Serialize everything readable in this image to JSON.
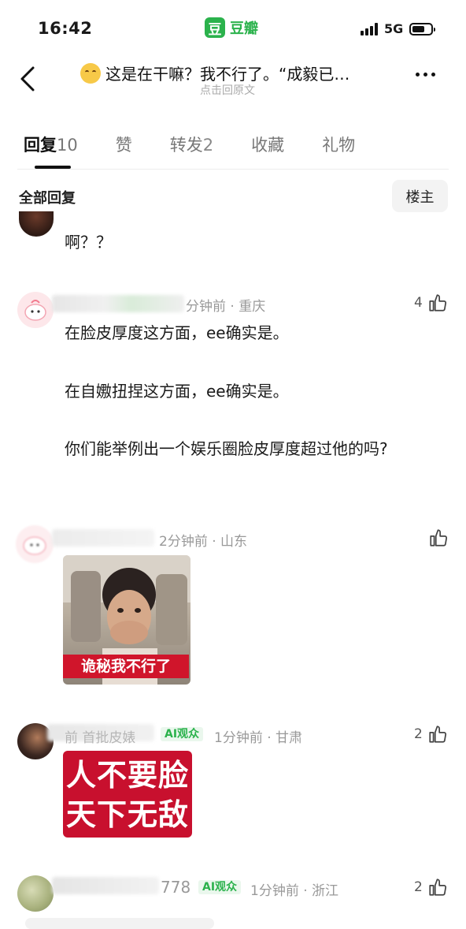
{
  "status_bar": {
    "time": "16:42",
    "app_logo_char": "豆",
    "app_name": "豆瓣",
    "network": "5G"
  },
  "header": {
    "title": "这是在干嘛？我不行了。“成毅已…",
    "subtitle": "点击回原文",
    "emoji_icon": "smiling-face-icon"
  },
  "tabs": [
    {
      "label": "回复",
      "count": "10",
      "active": true
    },
    {
      "label": "赞",
      "count": ""
    },
    {
      "label": "转发",
      "count": "2"
    },
    {
      "label": "收藏",
      "count": ""
    },
    {
      "label": "礼物",
      "count": ""
    }
  ],
  "filter": {
    "label": "全部回复",
    "op_button": "楼主"
  },
  "comments": [
    {
      "text": "啊？？"
    },
    {
      "meta": "分钟前 · 重庆",
      "likes": "4",
      "paragraphs": [
        "在脸皮厚度这方面，ee确实是。",
        "在自嫐扭捏这方面，ee确实是。",
        "你们能举例出一个娱乐圈脸皮厚度超过他的吗?"
      ]
    },
    {
      "meta": "2分钟前 · 山东",
      "likes": "",
      "sticker_caption": "诡秘我不行了"
    },
    {
      "name_partial": "前  首批皮婊",
      "tag": "AI观众",
      "meta": "1分钟前 · 甘肃",
      "likes": "2",
      "sticker_lines": [
        "人不要脸",
        "天下无敌"
      ]
    },
    {
      "name_partial": "778",
      "tag": "AI观众",
      "meta": "1分钟前 · 浙江",
      "likes": "2"
    }
  ],
  "colors": {
    "accent": "#2bb24c",
    "sticker_red": "#c8102e"
  }
}
